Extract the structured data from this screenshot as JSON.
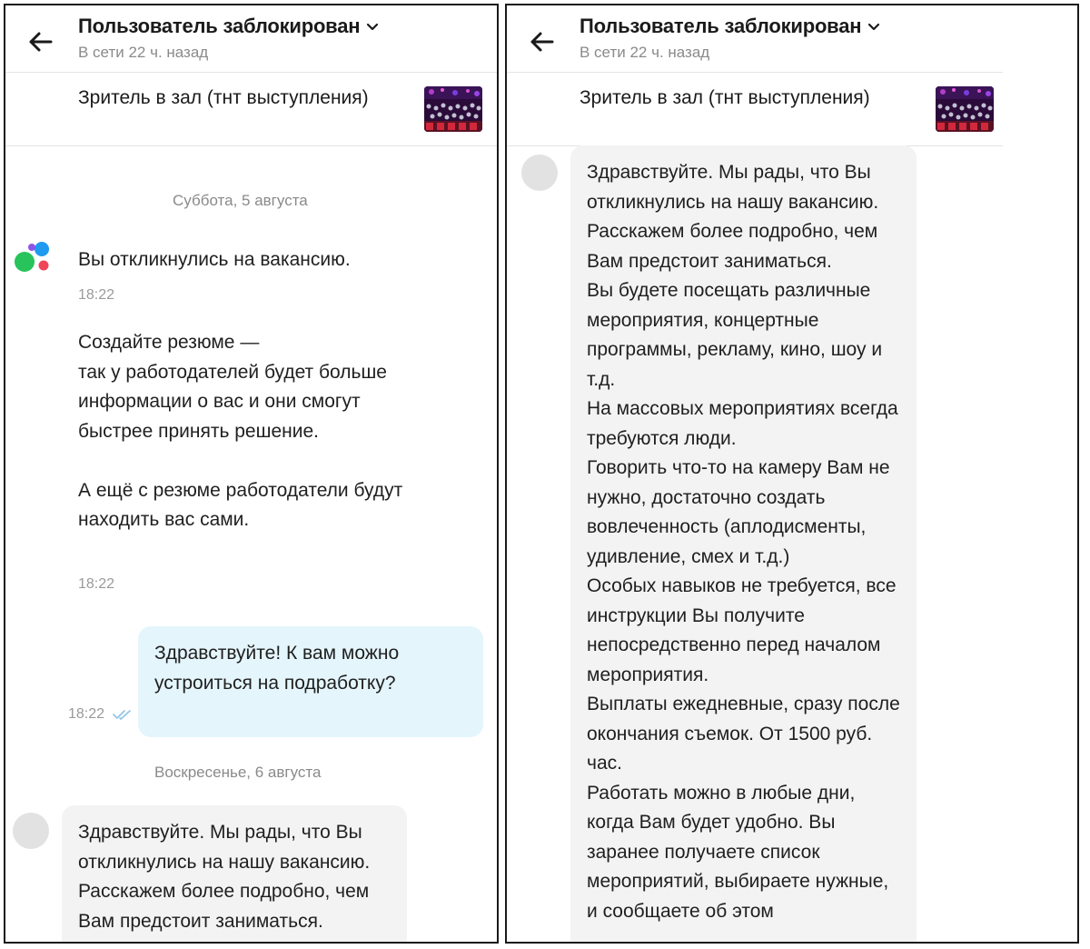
{
  "chat": {
    "header": {
      "title": "Пользователь заблокирован",
      "status": "В сети 22 ч. назад"
    },
    "ad": {
      "title": "Зритель в зал (тнт выступления)"
    }
  },
  "left": {
    "date1": "Суббота, 5 августа",
    "system_msg1": "Вы откликнулись на вакансию.",
    "time1": "18:22",
    "system_msg2": "Создайте резюме —\nтак у работодателей будет больше информации о вас и они смогут быстрее принять решение.\n\nА ещё с резюме работодатели будут находить вас сами.",
    "time2": "18:22",
    "outgoing": "Здравствуйте! К вам можно устроиться на подработку?",
    "outgoing_time": "18:22",
    "date2": "Воскресенье, 6 августа"
  },
  "incoming_message": "Здравствуйте. Мы рады, что Вы откликнулись на нашу вакансию. Расскажем более подробно, чем Вам предстоит заниматься.\nВы будете посещать различные мероприятия, концертные программы, рекламу, кино, шоу и т.д.\nНа массовых мероприятиях всегда требуются люди.\nГоворить что-то на камеру Вам не нужно, достаточно создать вовлеченность (аплодисменты, удивление, смех и т.д.)\nОсобых навыков не требуется, все инструкции Вы получите непосредственно перед началом мероприятия.\nВыплаты ежедневные, сразу после окончания съемок. От 1500 руб. час.\nРаботать можно в любые дни, когда Вам будет удобно. Вы заранее получаете список мероприятий, выбираете нужные, и сообщаете об этом",
  "colors": {
    "outgoing_bubble": "#e4f5fc",
    "incoming_bubble": "#f3f3f3",
    "muted_text": "#8a8a8a",
    "read_ticks": "#8fc3e6",
    "logo_green": "#28c35a",
    "logo_blue": "#1e9bf0",
    "logo_red": "#f0465a",
    "logo_purple": "#8c55e6"
  },
  "icons": [
    "back-arrow-icon",
    "chevron-down-icon",
    "double-check-icon",
    "avito-logo-icon"
  ]
}
